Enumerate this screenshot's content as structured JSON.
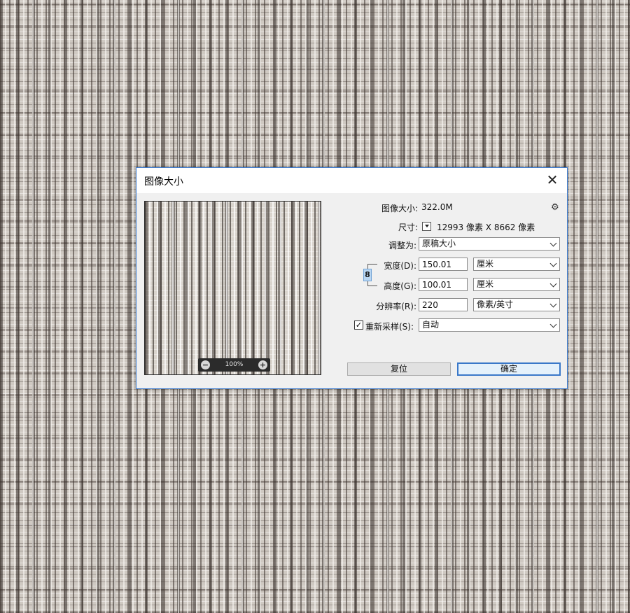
{
  "dialog": {
    "title": "图像大小",
    "close_glyph": "✕"
  },
  "preview": {
    "zoom": "100%",
    "zoom_out_glyph": "−",
    "zoom_in_glyph": "+"
  },
  "info": {
    "image_size_label": "图像大小:",
    "image_size_value": "322.0M",
    "dimensions_label": "尺寸:",
    "dimensions_value": "12993 像素  X  8662 像素"
  },
  "fit_to": {
    "label": "调整为:",
    "value": "原稿大小"
  },
  "width": {
    "label": "宽度(D):",
    "value": "150.01",
    "unit": "厘米"
  },
  "height": {
    "label": "高度(G):",
    "value": "100.01",
    "unit": "厘米"
  },
  "resolution": {
    "label": "分辨率(R):",
    "value": "220",
    "unit": "像素/英寸"
  },
  "resample": {
    "label": "重新采样(S):",
    "checked": true,
    "check_glyph": "✓",
    "value": "自动"
  },
  "buttons": {
    "reset": "复位",
    "ok": "确定"
  },
  "icons": {
    "gear": "⚙",
    "link": "8"
  },
  "colors": {
    "accent": "#3a78c9",
    "dialog_bg": "#f0f0f0"
  }
}
